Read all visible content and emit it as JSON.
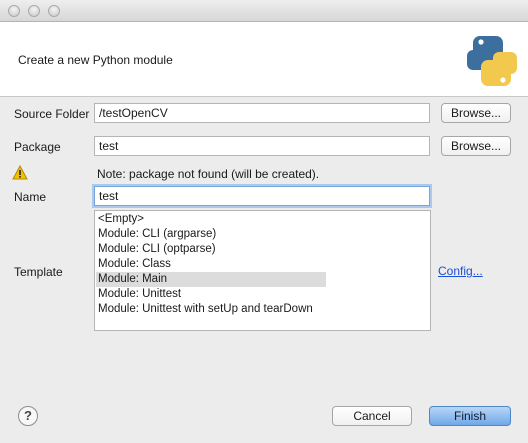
{
  "window": {
    "traffic_lights": [
      "close",
      "minimize",
      "zoom"
    ]
  },
  "header": {
    "description": "Create a new Python module",
    "logo": "python-logo"
  },
  "form": {
    "source_folder": {
      "label": "Source Folder",
      "value": "/testOpenCV",
      "browse_label": "Browse..."
    },
    "package": {
      "label": "Package",
      "value": "test",
      "browse_label": "Browse..."
    },
    "warning": {
      "icon": "warning-triangle-icon",
      "text": "Note: package not found (will be created)."
    },
    "name": {
      "label": "Name",
      "value": "test"
    },
    "template": {
      "label": "Template",
      "items": [
        "<Empty>",
        "Module: CLI (argparse)",
        "Module: CLI (optparse)",
        "Module: Class",
        "Module: Main",
        "Module: Unittest",
        "Module: Unittest with setUp and tearDown"
      ],
      "selected": "Module: Main",
      "config_link": "Config..."
    }
  },
  "footer": {
    "help": "?",
    "cancel_label": "Cancel",
    "finish_label": "Finish"
  },
  "colors": {
    "accent": "#6fa8e8",
    "link": "#1a4fd6",
    "warning": "#f2c200",
    "python_blue": "#3c6e9e",
    "python_yellow": "#f2c94c"
  }
}
